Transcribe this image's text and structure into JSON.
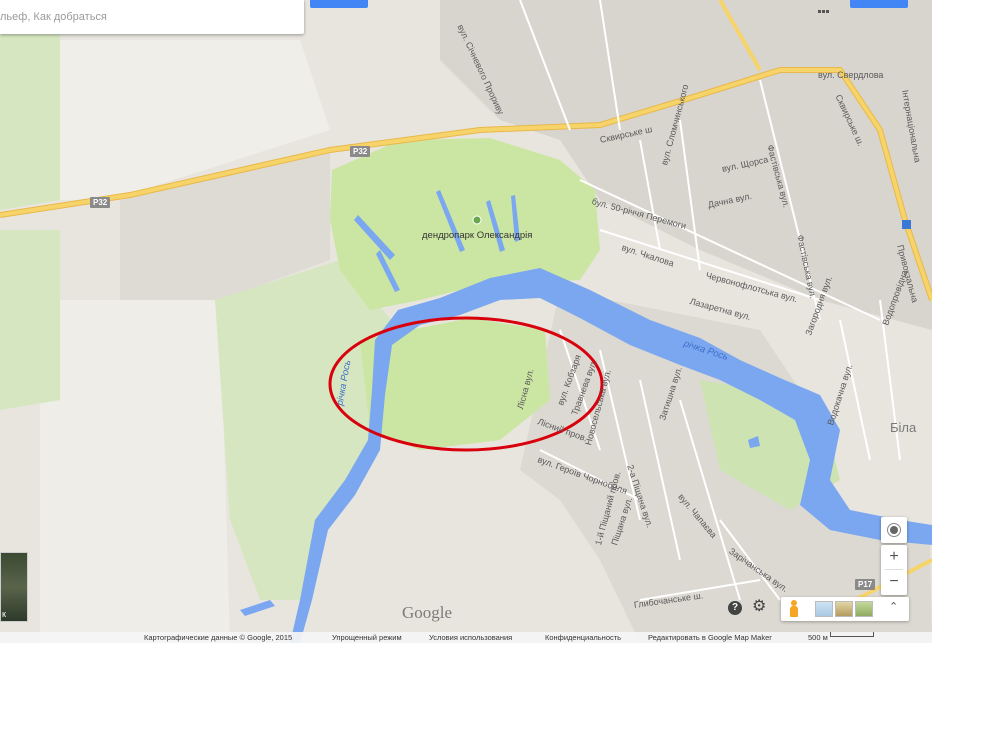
{
  "search": {
    "placeholder": "льеф, Как добраться"
  },
  "roads": {
    "r32_a": "P32",
    "r32_b": "P32",
    "p17": "P17",
    "skvyrske_top": "Сквирське ш",
    "skvyrske_right": "Сквирське ш.",
    "sichnevyi": "вул. Січневого Прориву",
    "sverdlova": "вул. Свердлова",
    "international": "Інтернаціональна",
    "slomchynskoho": "вул. Сломчинського",
    "shchorsa": "вул. Щорса",
    "fastivska": "Фастівська вул.",
    "50_richchia": "бул. 50-річчя Перемоги",
    "dachna": "Дачна вул.",
    "chkalova": "вул. Чкалова",
    "chervonoflotska": "Червонофлотська вул.",
    "lazaretna": "Лазаретна вул.",
    "privokzalna": "Привокзальна",
    "zahorodnia": "Загородня вул.",
    "vodoprovidna": "Водопровідна",
    "vodokachna": "Водокачна вул.",
    "lisna": "Лісна вул.",
    "kobzarja": "вул. Кобзаря",
    "travneva": "Травнева вул.",
    "lisnyi_prov": "Лісний пров.",
    "novoselska": "Новосельська вул.",
    "heroiv_chornobylia": "вул. Героїв Чорнобиля",
    "druha_pishchana": "2-а Піщана вул.",
    "zatyshna": "Затишна вул.",
    "chapaieva": "вул. Чапаєва",
    "pershyi_pishchanyi": "1-й Піщаний пров.",
    "pishchana": "Піщана вул.",
    "zarechanska": "Зарічанська вул.",
    "hlybochanske": "Глибочанське ш.",
    "fastivska_right": "Фастівська вул."
  },
  "places": {
    "park": "дендропарк Олександрія",
    "river_left": "річка Рось",
    "river_right": "річка Рось",
    "city_partial": "Біла"
  },
  "map_controls": {
    "zoom_in": "+",
    "zoom_out": "−",
    "help": "?",
    "earth_label": "к",
    "google_logo": "Google"
  },
  "footer": {
    "map_data": "Картографические данные © Google, 2015",
    "simple_mode": "Упрощенный режим",
    "terms": "Условия использования",
    "privacy": "Конфиденциальность",
    "edit": "Редактировать в Google Map Maker",
    "scale": "500 м"
  },
  "colors": {
    "land": "#e8e5df",
    "park_green": "#cbe6a3",
    "forest_green": "#d6e6c1",
    "water": "#7aa7f0",
    "highway": "#f7d46a",
    "urban": "#d8d5ce",
    "highlight_circle": "#d9000d"
  }
}
